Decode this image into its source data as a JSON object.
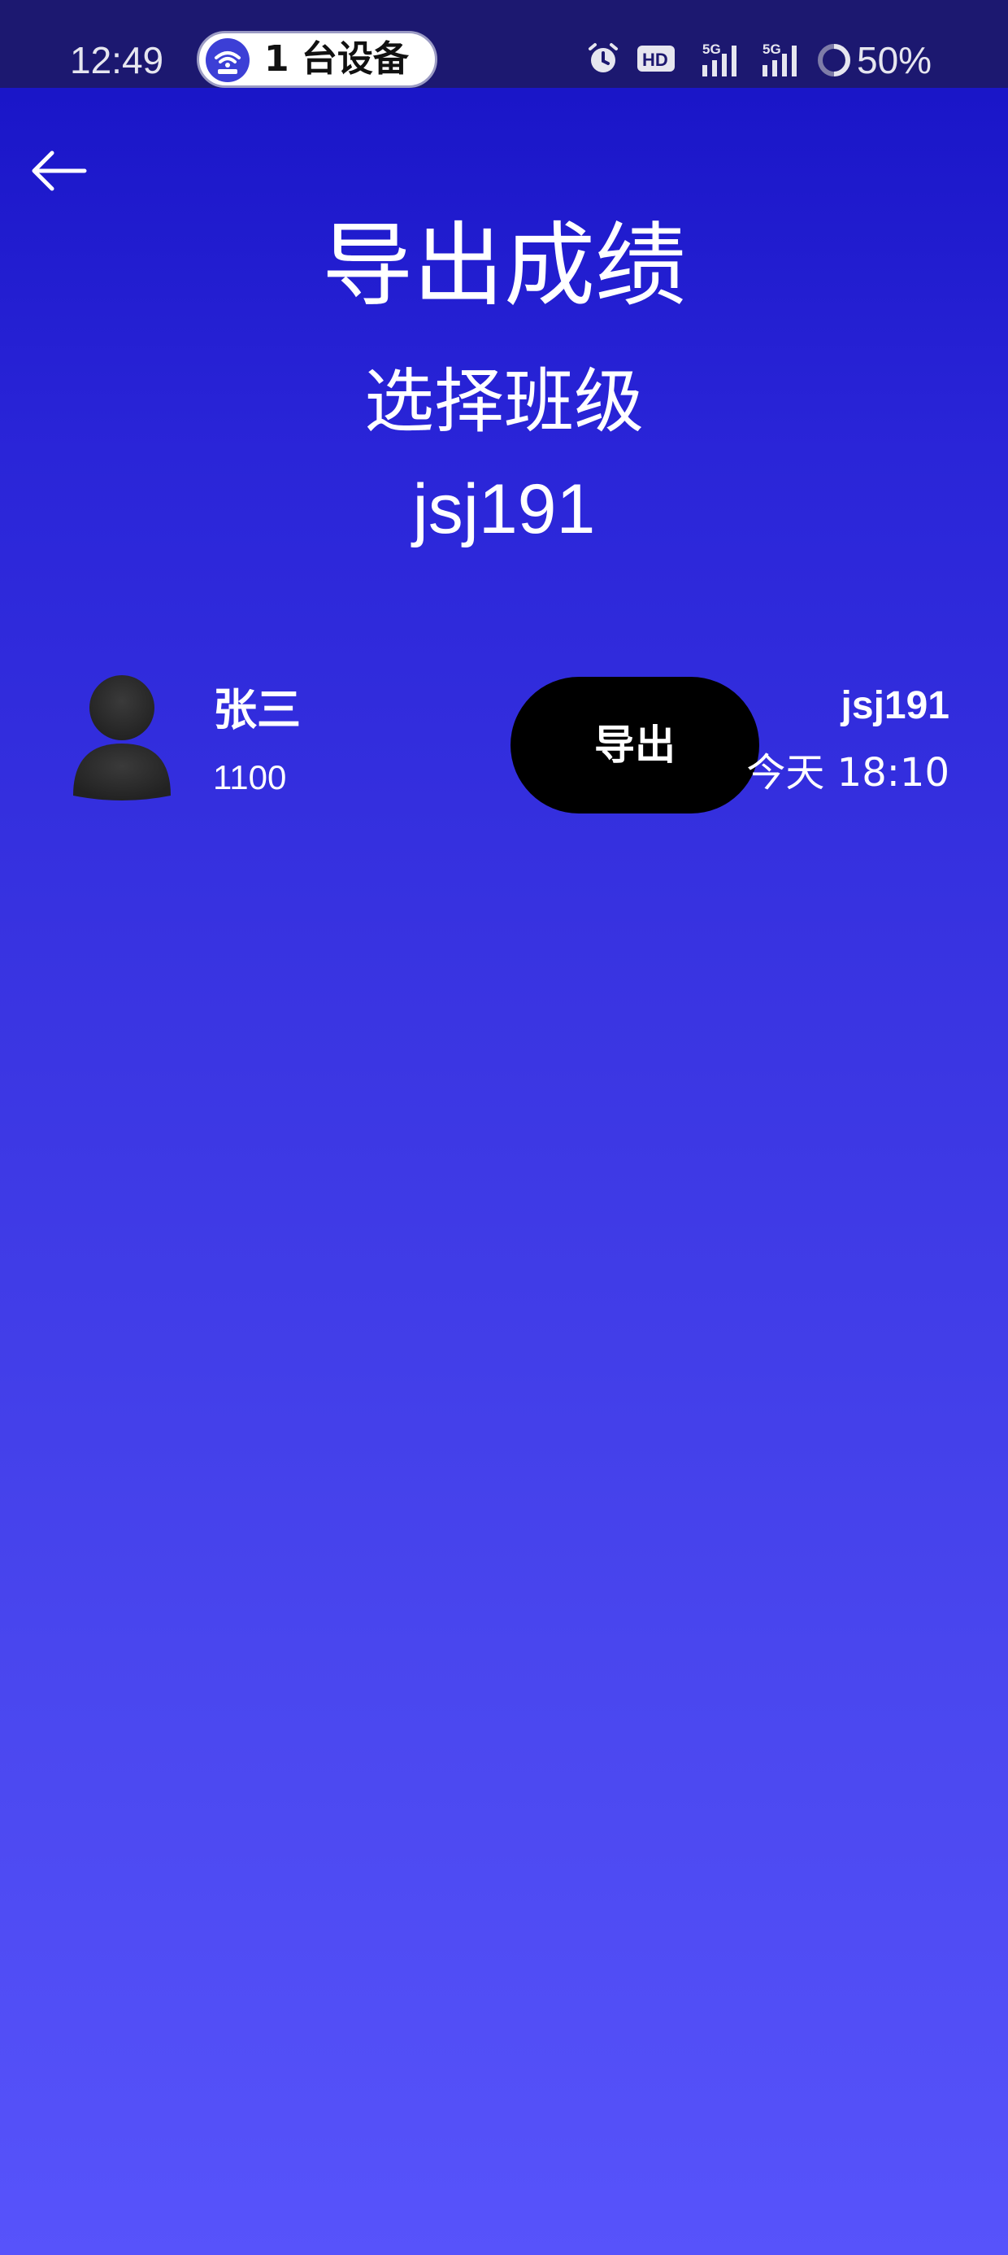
{
  "status_bar": {
    "time": "12:49",
    "device_pill": "1 台设备",
    "battery": "50%",
    "icons": [
      "wifi-hotspot-icon",
      "alarm-icon",
      "hd-icon",
      "signal-5g-icon",
      "signal-5g-icon",
      "battery-icon"
    ]
  },
  "header": {
    "title": "导出成绩",
    "subtitle": "选择班级",
    "class_name": "jsj191"
  },
  "list": {
    "items": [
      {
        "name": "张三",
        "id": "1100",
        "button_label": "导出",
        "class": "jsj191",
        "time": "今天 18:10"
      }
    ]
  },
  "colors": {
    "gradient_top": "#1612c4",
    "gradient_bottom": "#5753fb",
    "status_bar": "#1c1870",
    "button": "#000000",
    "text": "#ffffff"
  }
}
